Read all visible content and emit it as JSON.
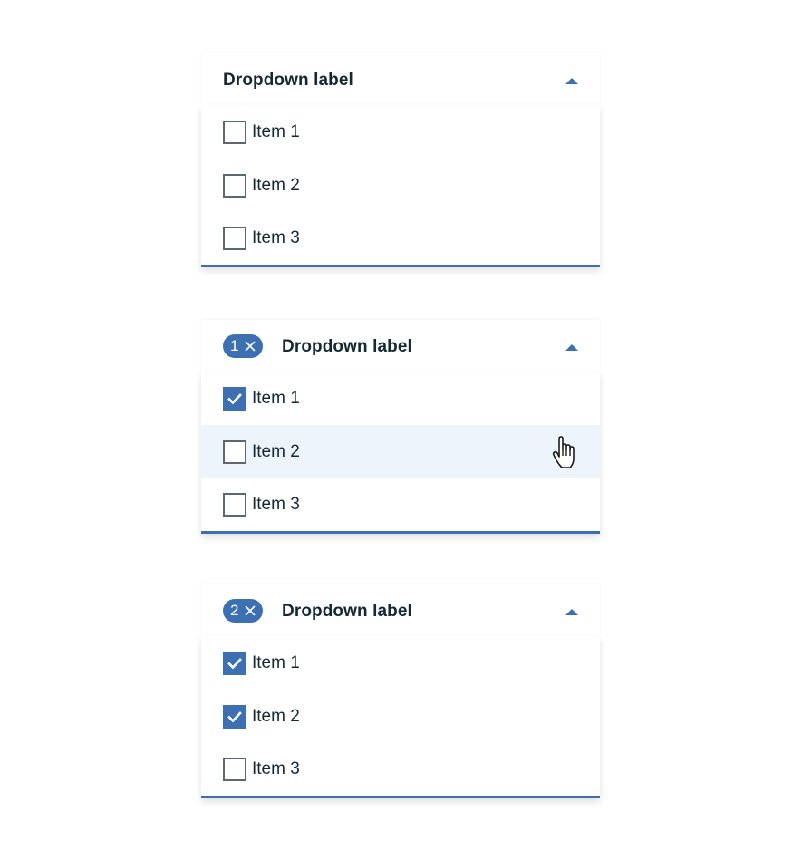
{
  "dropdowns": [
    {
      "label": "Dropdown label",
      "selected_count": "",
      "items": [
        {
          "label": "Item 1",
          "checked": false
        },
        {
          "label": "Item 2",
          "checked": false
        },
        {
          "label": "Item 3",
          "checked": false
        }
      ]
    },
    {
      "label": "Dropdown label",
      "selected_count": "1",
      "items": [
        {
          "label": "Item 1",
          "checked": true
        },
        {
          "label": "Item 2",
          "checked": false,
          "hovered": true
        },
        {
          "label": "Item 3",
          "checked": false
        }
      ]
    },
    {
      "label": "Dropdown label",
      "selected_count": "2",
      "items": [
        {
          "label": "Item 1",
          "checked": true
        },
        {
          "label": "Item 2",
          "checked": true
        },
        {
          "label": "Item 3",
          "checked": false
        }
      ]
    }
  ],
  "icons": {
    "caret": "caret-up-icon",
    "clear": "close-icon",
    "check": "checkmark-icon",
    "cursor": "hand-pointer-icon"
  },
  "colors": {
    "accent": "#3d70b2",
    "text": "#152935",
    "checkbox_border": "#5a6872",
    "hover_bg": "#eef4fc"
  }
}
